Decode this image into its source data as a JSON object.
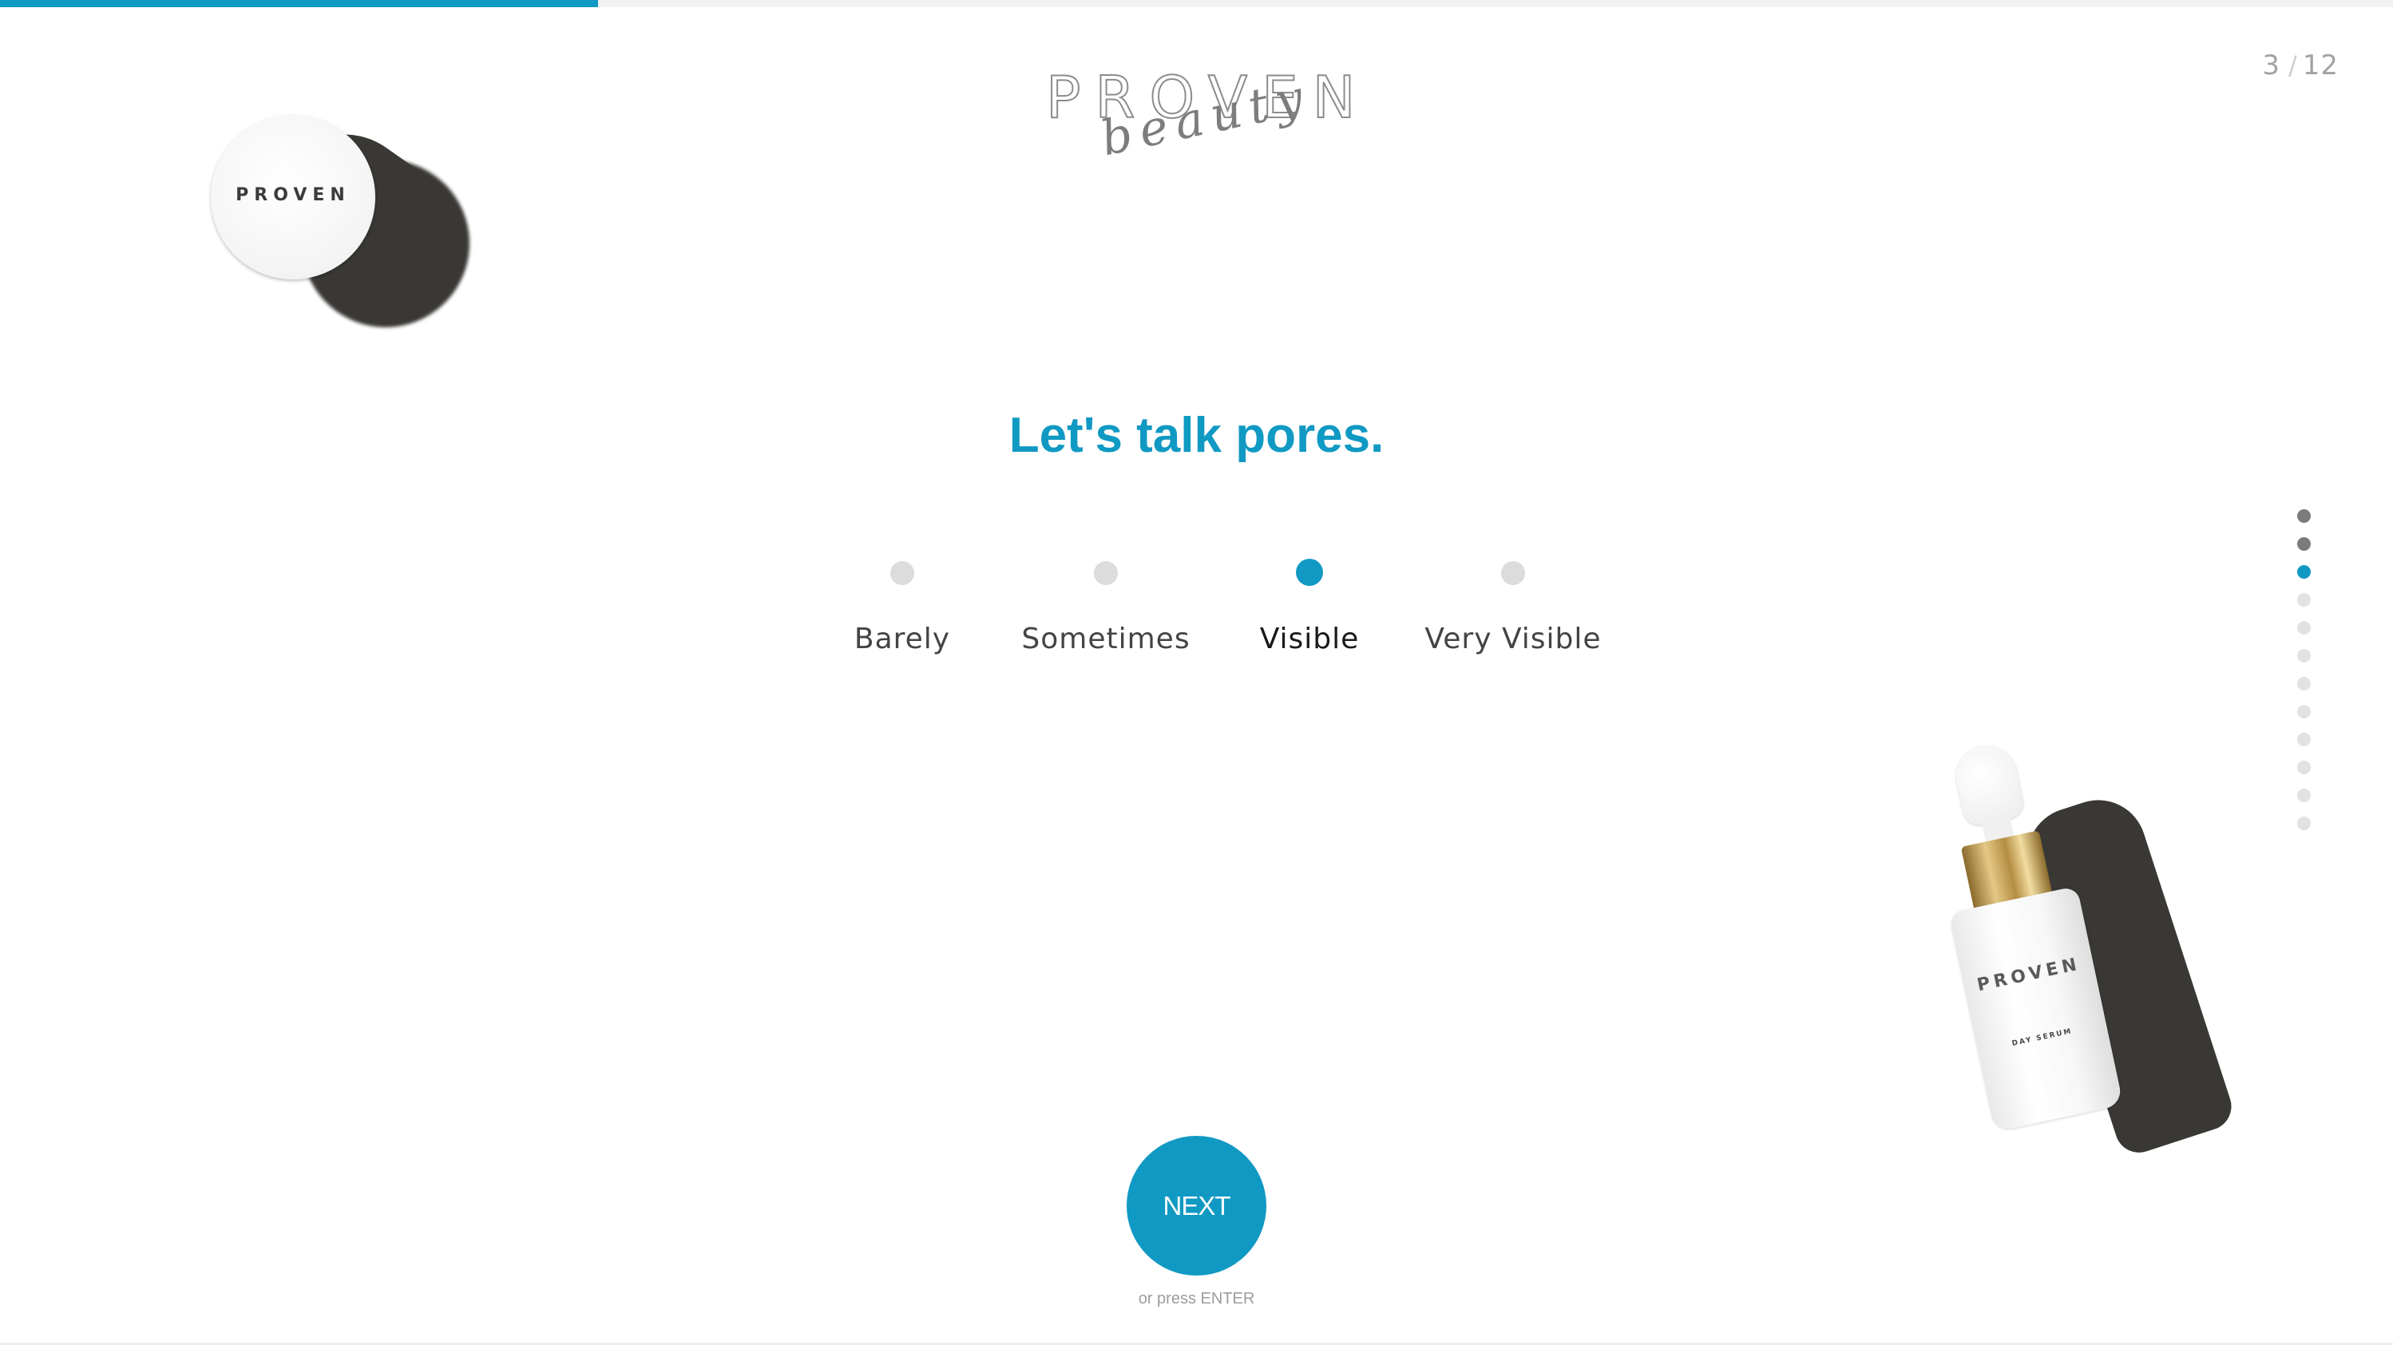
{
  "progress": {
    "fraction": 0.25
  },
  "page_counter": {
    "current": "3",
    "separator": "/",
    "total": "12"
  },
  "logo": {
    "wordmark": "PROVEN",
    "script": "beauty"
  },
  "decor": {
    "jar_label": "PROVEN",
    "bottle_label": "PROVEN",
    "bottle_sublabel": "DAY SERUM"
  },
  "question": {
    "heading": "Let's talk pores."
  },
  "options": [
    {
      "label": "Barely",
      "selected": false
    },
    {
      "label": "Sometimes",
      "selected": false
    },
    {
      "label": "Visible",
      "selected": true
    },
    {
      "label": "Very Visible",
      "selected": false
    }
  ],
  "step_indicator": {
    "total": 12,
    "current": 3
  },
  "actions": {
    "next_label": "NEXT",
    "enter_hint": "or press ENTER"
  },
  "colors": {
    "accent": "#1099c3",
    "inactive_dot": "#dcdcdc",
    "done_dot": "#7b7b7b"
  }
}
